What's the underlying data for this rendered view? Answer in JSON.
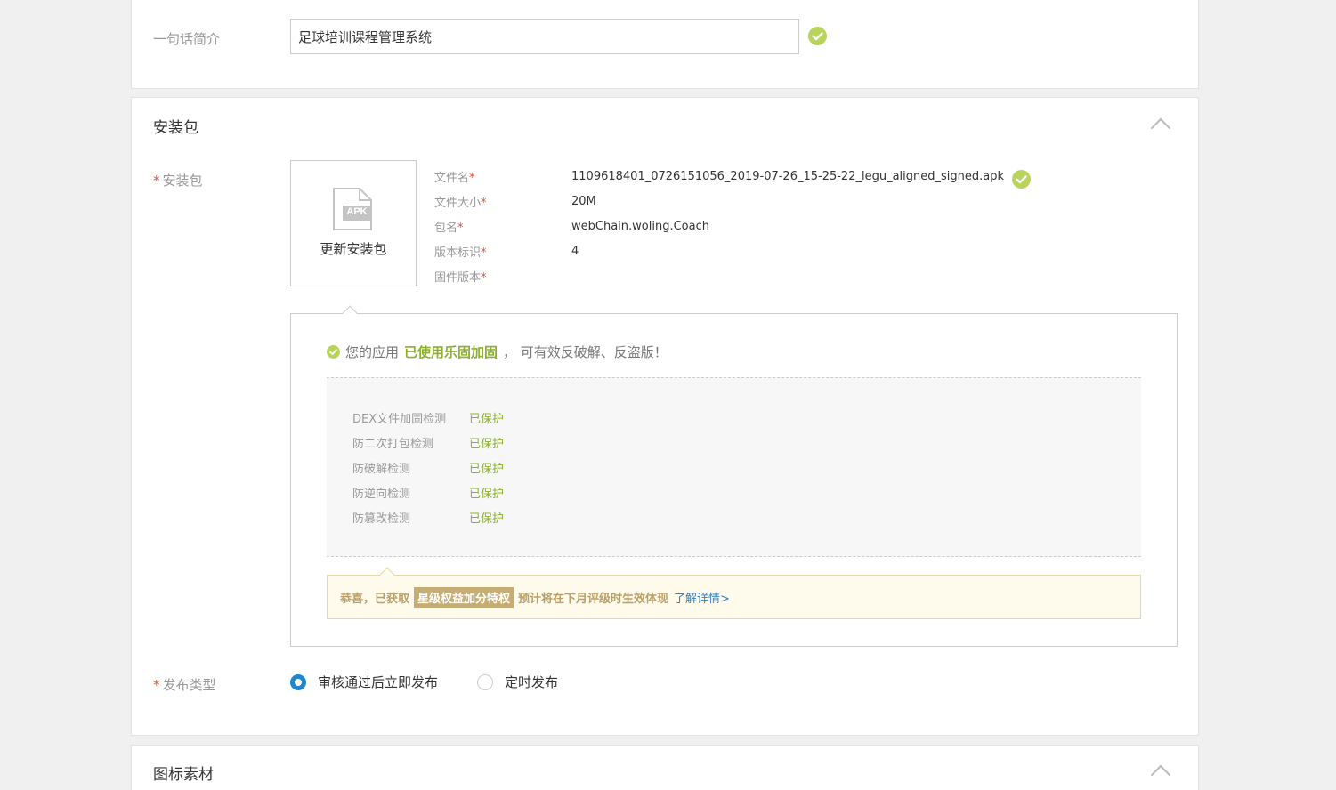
{
  "intro": {
    "label": "一句话简介",
    "value": "足球培训课程管理系统"
  },
  "package_section": {
    "title": "安装包",
    "field_label": "安装包",
    "required_mark": "*",
    "upload": {
      "badge": "APK",
      "label": "更新安装包"
    },
    "file_info": [
      {
        "key": "文件名",
        "value": "1109618401_0726151056_2019-07-26_15-25-22_legu_aligned_signed.apk"
      },
      {
        "key": "文件大小",
        "value": "20M"
      },
      {
        "key": "包名",
        "value": "webChain.woling.Coach"
      },
      {
        "key": "版本标识",
        "value": "4"
      },
      {
        "key": "固件版本",
        "value": ""
      }
    ],
    "security": {
      "prefix": "您的应用",
      "highlight": "已使用乐固加固",
      "suffix": "，  可有效反破解、反盗版！",
      "checks": [
        {
          "name": "DEX文件加固检测",
          "status": "已保护"
        },
        {
          "name": "防二次打包检测",
          "status": "已保护"
        },
        {
          "name": "防破解检测",
          "status": "已保护"
        },
        {
          "name": "防逆向检测",
          "status": "已保护"
        },
        {
          "name": "防篡改检测",
          "status": "已保护"
        }
      ]
    },
    "reward": {
      "prefix": "恭喜，已获取",
      "badge": "星级权益加分特权",
      "suffix": "预计将在下月评级时生效体现",
      "link": "了解详情>"
    },
    "publish": {
      "label": "发布类型",
      "options": [
        {
          "label": "审核通过后立即发布",
          "checked": true
        },
        {
          "label": "定时发布",
          "checked": false
        }
      ]
    }
  },
  "icons_section": {
    "title": "图标素材"
  },
  "colors": {
    "accent_blue": "#1d87d0",
    "success_green": "#b9d45c",
    "required_red": "#e74c3c"
  }
}
